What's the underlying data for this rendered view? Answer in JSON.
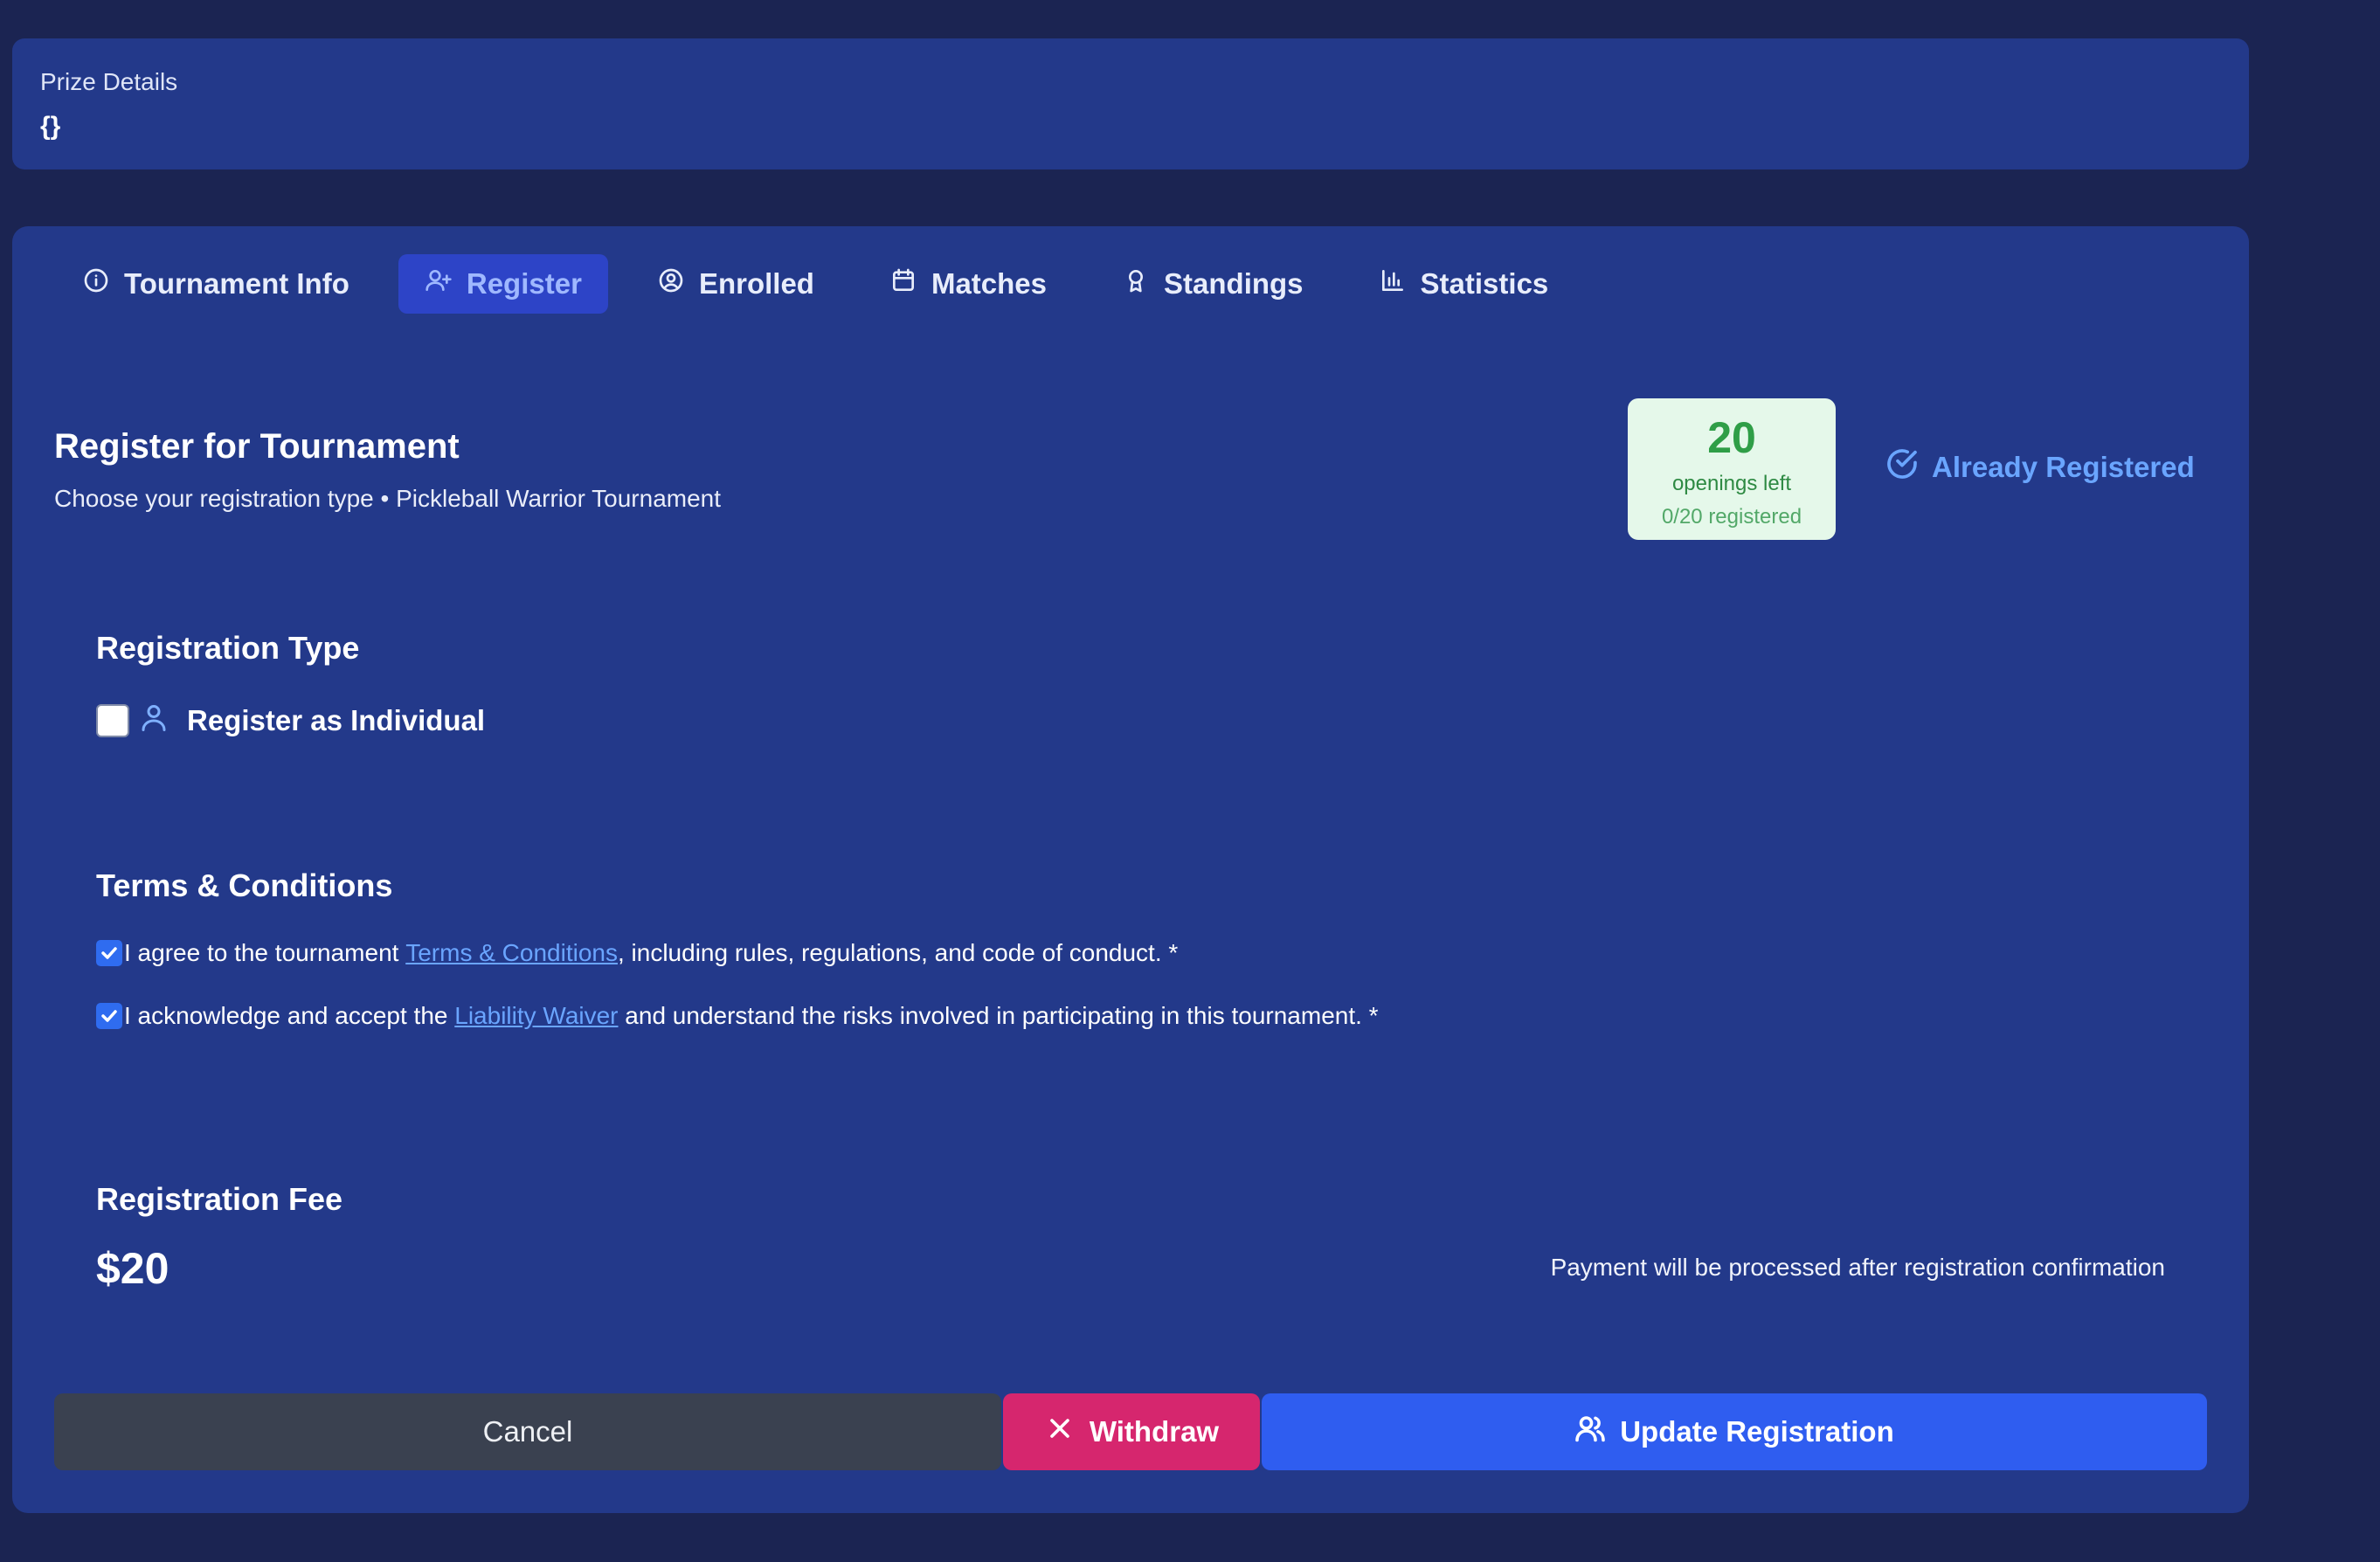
{
  "prize": {
    "label": "Prize Details",
    "value": "{}"
  },
  "tabs": [
    {
      "label": "Tournament Info",
      "icon": "info-icon",
      "active": false
    },
    {
      "label": "Register",
      "icon": "user-plus-icon",
      "active": true
    },
    {
      "label": "Enrolled",
      "icon": "user-circle-icon",
      "active": false
    },
    {
      "label": "Matches",
      "icon": "calendar-icon",
      "active": false
    },
    {
      "label": "Standings",
      "icon": "award-icon",
      "active": false
    },
    {
      "label": "Statistics",
      "icon": "bar-chart-icon",
      "active": false
    }
  ],
  "register": {
    "title": "Register for Tournament",
    "subtitle": "Choose your registration type • Pickleball Warrior Tournament",
    "openings": {
      "count": "20",
      "label": "openings left",
      "registered": "0/20 registered"
    },
    "status": "Already Registered"
  },
  "registration_type": {
    "heading": "Registration Type",
    "option_label": "Register as Individual",
    "checked": false
  },
  "terms": {
    "heading": "Terms & Conditions",
    "items": [
      {
        "prefix": "I agree to the tournament ",
        "link": "Terms & Conditions",
        "suffix": ", including rules, regulations, and code of conduct. *",
        "checked": true
      },
      {
        "prefix": "I acknowledge and accept the ",
        "link": "Liability Waiver",
        "suffix": " and understand the risks involved in participating in this tournament. *",
        "checked": true
      }
    ]
  },
  "fee": {
    "heading": "Registration Fee",
    "amount": "$20",
    "note": "Payment will be processed after registration confirmation"
  },
  "buttons": {
    "cancel": "Cancel",
    "withdraw": "Withdraw",
    "update": "Update Registration"
  },
  "colors": {
    "background": "#1b2452",
    "card": "#23398a",
    "active_tab": "#2d44c7",
    "accent_link": "#6aa5ff",
    "openings_bg": "#e5f8ea",
    "openings_text": "#2f9e47",
    "cancel": "#3a4150",
    "withdraw": "#d6266e",
    "update": "#2f5df0"
  }
}
